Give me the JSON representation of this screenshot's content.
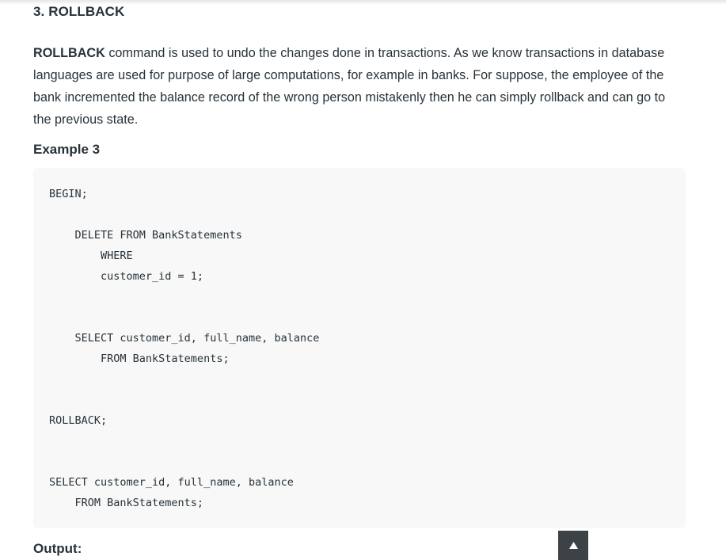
{
  "section": {
    "title": "3. ROLLBACK"
  },
  "paragraph": {
    "lead": "ROLLBACK",
    "rest": " command is used to undo the changes done in transactions. As we know transactions in database languages are used for purpose of large computations, for example in banks. For suppose, the employee of the bank incremented the balance record of the wrong person mistakenly then he can simply rollback and can go to the previous state."
  },
  "example": {
    "title": "Example 3"
  },
  "code": {
    "lines": [
      "BEGIN;",
      "    DELETE FROM BankStatements",
      "        WHERE",
      "        customer_id = 1;",
      "    SELECT customer_id, full_name, balance",
      "        FROM BankStatements;",
      "ROLLBACK;",
      "SELECT customer_id, full_name, balance",
      "    FROM BankStatements;"
    ]
  },
  "output": {
    "title": "Output:"
  },
  "scroll_top": {
    "icon": "arrow-up-icon"
  }
}
